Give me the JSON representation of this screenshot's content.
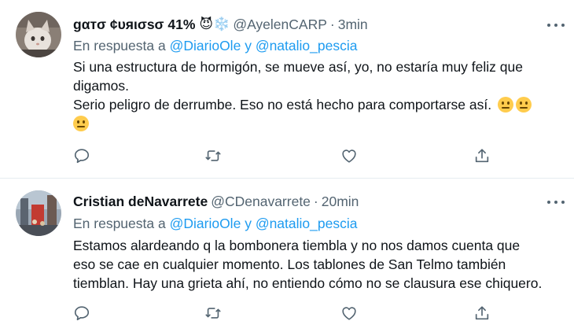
{
  "tweets": [
    {
      "display_name": "gαтσ ¢υяισѕσ 41%",
      "name_emojis": "😈❄️",
      "handle": "@AyelenCARP",
      "separator": "·",
      "time": "3min",
      "reply_prefix": "En respuesta a",
      "reply_mention_1": "@DiarioOle",
      "reply_conjunction": "y",
      "reply_mention_2": "@natalio_pescia",
      "lines": [
        "Si una estructura de hormigón, se mueve así, yo, no estaría muy feliz que",
        "digamos.",
        "Serio peligro de derrumbe. Eso no está hecho para comportarse así."
      ],
      "line_emojis": "😐😐😐"
    },
    {
      "display_name": "Cristian deNavarrete",
      "handle": "@CDenavarrete",
      "separator": "·",
      "time": "20min",
      "reply_prefix": "En respuesta a",
      "reply_mention_1": "@DiarioOle",
      "reply_conjunction": "y",
      "reply_mention_2": "@natalio_pescia",
      "lines": [
        "Estamos alardeando q la bombonera tiembla y no nos damos cuenta que",
        "eso se cae en cualquier momento. Los tablones de San Telmo también",
        "tiemblan. Hay una grieta ahí, no entiendo cómo no se clausura ese chiquero."
      ]
    }
  ],
  "icons": {
    "more": "more-icon",
    "reply": "reply-icon",
    "retweet": "retweet-icon",
    "like": "like-icon",
    "share": "share-icon"
  },
  "colors": {
    "link": "#1d9bf0",
    "secondary_text": "#536471",
    "primary_text": "#0f1419",
    "divider": "#e6ecf0"
  }
}
